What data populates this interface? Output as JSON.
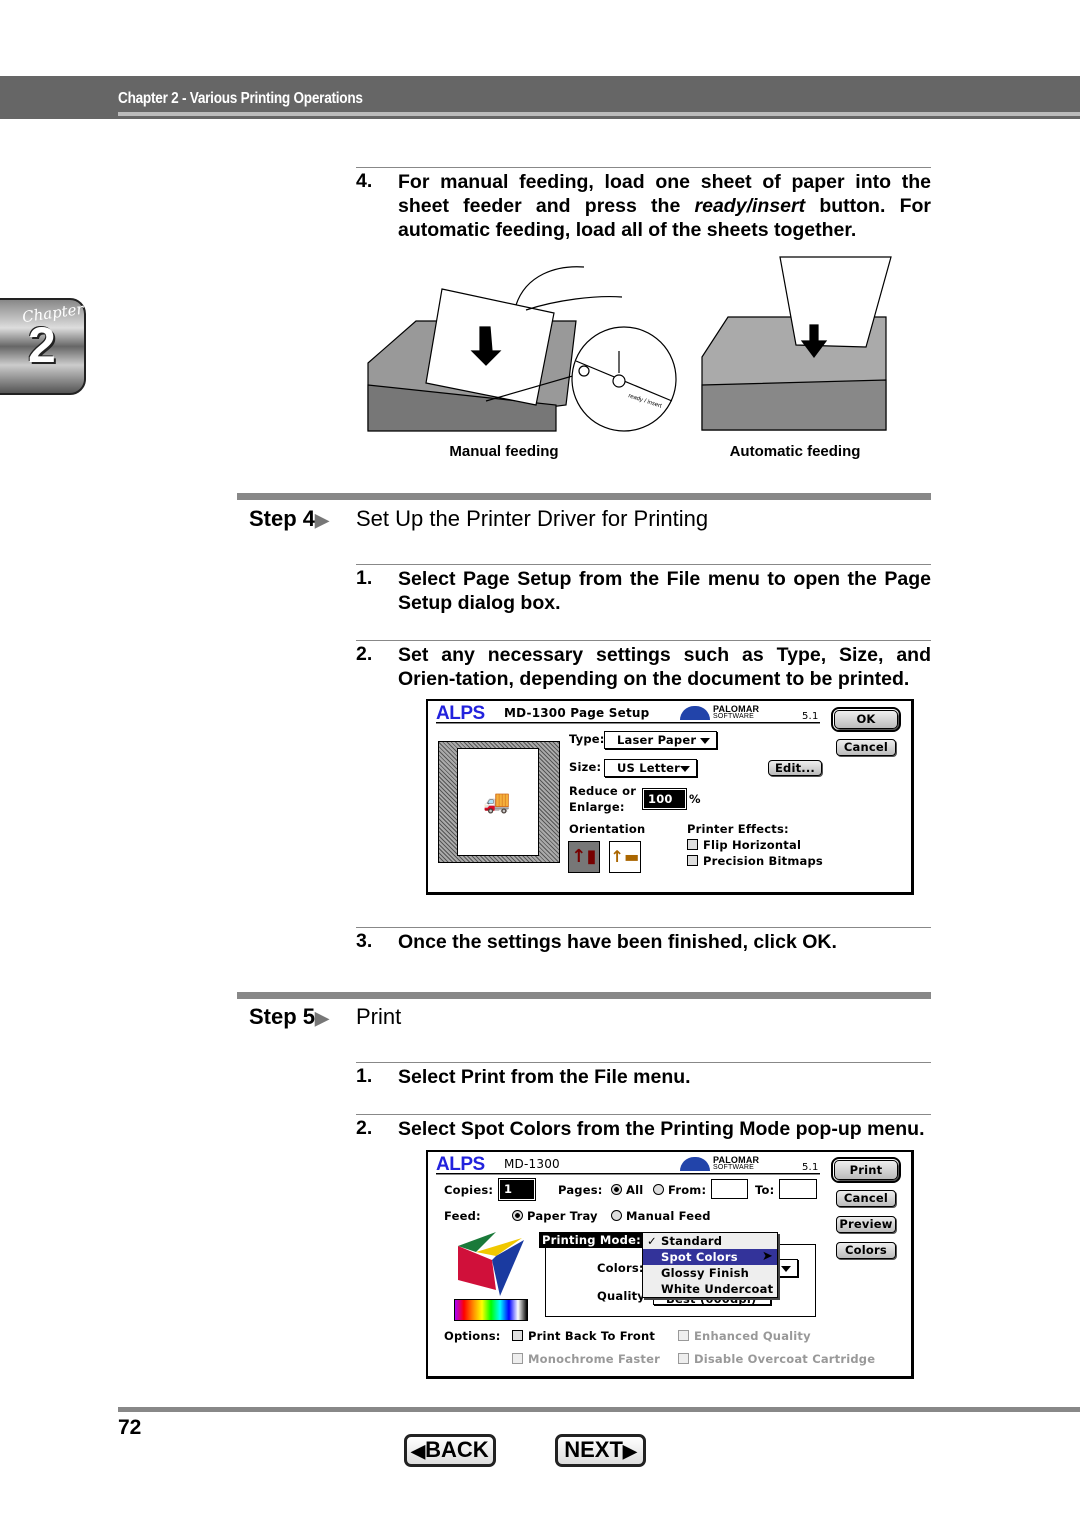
{
  "header": {
    "chapter_title": "Chapter 2 - Various Printing Operations"
  },
  "chapter_tab": {
    "label": "Chapter",
    "number": "2"
  },
  "step4_pre": {
    "number": "4.",
    "text_a": "For manual feeding, load one sheet of paper into the sheet feeder and press the ",
    "text_em": "ready/insert",
    "text_b": " button. For automatic feeding, load all of the sheets together."
  },
  "figure": {
    "caption_manual": "Manual feeding",
    "caption_auto": "Automatic feeding",
    "inset_label": "ready / insert"
  },
  "step4": {
    "label": "Step 4",
    "arrow": "▶",
    "title": "Set Up the Printer Driver for Printing",
    "items": [
      {
        "number": "1.",
        "text": "Select Page Setup from the File menu to open the Page Setup dialog box."
      },
      {
        "number": "2.",
        "text": "Set any necessary settings such as Type, Size, and Orien-tation, depending on the document to be printed."
      },
      {
        "number": "3.",
        "text": "Once the settings have been finished, click OK."
      }
    ]
  },
  "page_setup": {
    "brand": "ALPS",
    "title": "MD-1300 Page Setup",
    "vendor": "PALOMAR",
    "vendor_sub": "SOFTWARE",
    "version": "5.1",
    "ok": "OK",
    "cancel": "Cancel",
    "type_label": "Type:",
    "type_value": "Laser Paper",
    "size_label": "Size:",
    "size_value": "US Letter",
    "edit": "Edit...",
    "reduce_label_1": "Reduce or",
    "reduce_label_2": "Enlarge:",
    "reduce_value": "100",
    "percent": "%",
    "orientation_label": "Orientation",
    "effects_label": "Printer Effects:",
    "flip": "Flip Horizontal",
    "precision": "Precision Bitmaps"
  },
  "step5": {
    "label": "Step 5",
    "arrow": "▶",
    "title": "Print",
    "items": [
      {
        "number": "1.",
        "text": "Select Print from the File menu."
      },
      {
        "number": "2.",
        "text": "Select Spot Colors from the Printing Mode pop-up menu."
      }
    ]
  },
  "print_dialog": {
    "brand": "ALPS",
    "title": "MD-1300",
    "vendor": "PALOMAR",
    "vendor_sub": "SOFTWARE",
    "version": "5.1",
    "print": "Print",
    "cancel": "Cancel",
    "preview": "Preview",
    "colors_btn": "Colors",
    "copies_label": "Copies:",
    "copies_value": "1",
    "pages_label": "Pages:",
    "all": "All",
    "from": "From:",
    "to": "To:",
    "feed_label": "Feed:",
    "paper_tray": "Paper Tray",
    "manual_feed": "Manual Feed",
    "printing_mode_label": "Printing Mode:",
    "mode_options": [
      {
        "label": "Standard",
        "checked": true
      },
      {
        "label": "Spot Colors",
        "highlighted": true
      },
      {
        "label": "Glossy Finish"
      },
      {
        "label": "White Undercoat"
      }
    ],
    "colors_label": "Colors:",
    "quality_label": "Quality:",
    "quality_value": "Best (600dpi)",
    "options_label": "Options:",
    "print_back": "Print Back To Front",
    "enhanced": "Enhanced Quality",
    "mono": "Monochrome Faster",
    "disable_overcoat": "Disable Overcoat Cartridge",
    "selected_color": "#33339a"
  },
  "footer": {
    "page_number": "72",
    "back": "BACK",
    "next": "NEXT"
  }
}
